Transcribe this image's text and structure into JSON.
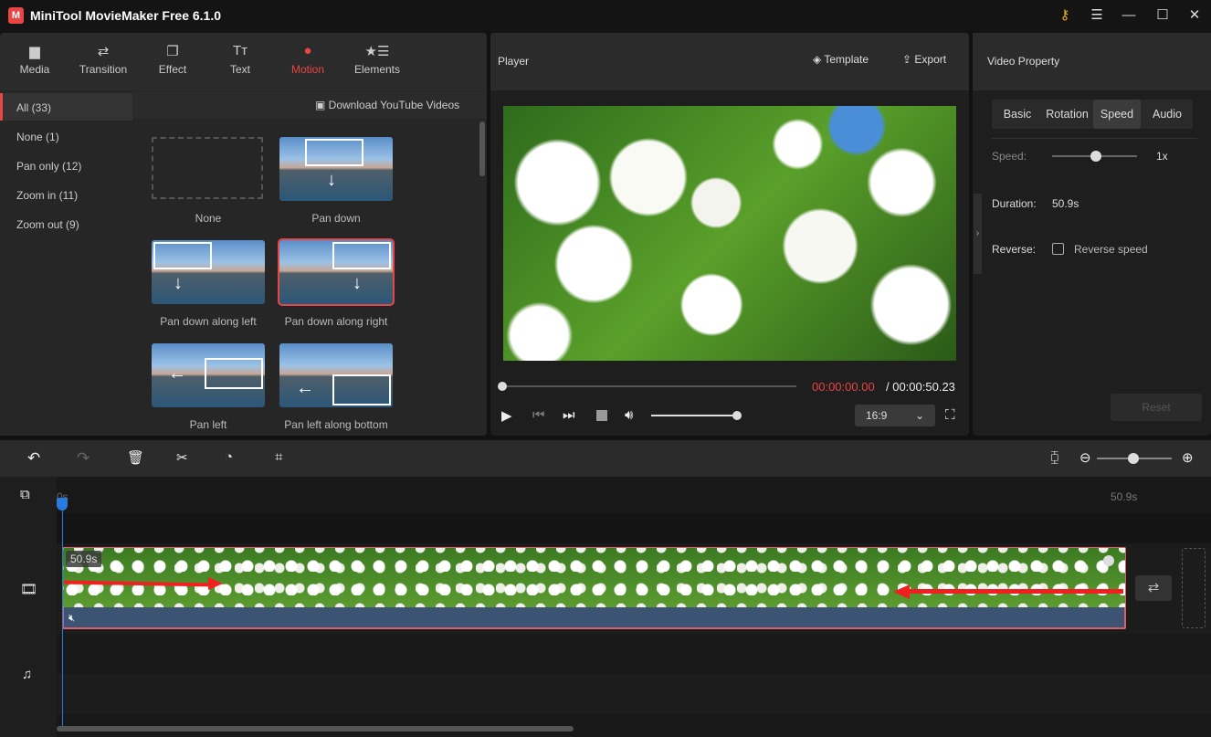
{
  "app": {
    "title": "MiniTool MovieMaker Free 6.1.0",
    "logo_text": "M"
  },
  "window": {
    "key_icon": "key-icon",
    "menu": "☰",
    "minimize": "—",
    "maximize": "☐",
    "close": "✕"
  },
  "toolbar": [
    {
      "label": "Media",
      "icon": "▆"
    },
    {
      "label": "Transition",
      "icon": "⇄"
    },
    {
      "label": "Effect",
      "icon": "❐"
    },
    {
      "label": "Text",
      "icon": "Tт"
    },
    {
      "label": "Motion",
      "icon": "●",
      "active": true
    },
    {
      "label": "Elements",
      "icon": "★☰"
    }
  ],
  "accent": "#e84545",
  "categories": [
    {
      "label": "All (33)",
      "active": true
    },
    {
      "label": "None (1)"
    },
    {
      "label": "Pan only (12)"
    },
    {
      "label": "Zoom in (11)"
    },
    {
      "label": "Zoom out (9)"
    }
  ],
  "download_label": "Download YouTube Videos",
  "motions": [
    {
      "label": "None"
    },
    {
      "label": "Pan down"
    },
    {
      "label": "Pan down along left"
    },
    {
      "label": "Pan down along right",
      "selected": true
    },
    {
      "label": "Pan left"
    },
    {
      "label": "Pan left along bottom"
    }
  ],
  "player": {
    "title": "Player",
    "template": "Template",
    "export": "Export",
    "current_time": "00:00:00.00",
    "total_time": "/ 00:00:50.23",
    "aspect": "16:9",
    "progress": 0,
    "volume": 0.9
  },
  "property": {
    "title": "Video Property",
    "tabs": [
      "Basic",
      "Rotation",
      "Speed",
      "Audio"
    ],
    "active_tab": "Speed",
    "speed_label": "Speed:",
    "speed_value": "1x",
    "speed_fraction": 0.5,
    "duration_label": "Duration:",
    "duration_value": "50.9s",
    "reverse_label": "Reverse:",
    "reverse_checkbox": "Reverse speed",
    "reverse_checked": false,
    "reset": "Reset"
  },
  "timeline": {
    "ruler_start": "0s",
    "ruler_end": "50.9s",
    "clip_duration": "50.9s",
    "zoom_level": 0.7
  }
}
